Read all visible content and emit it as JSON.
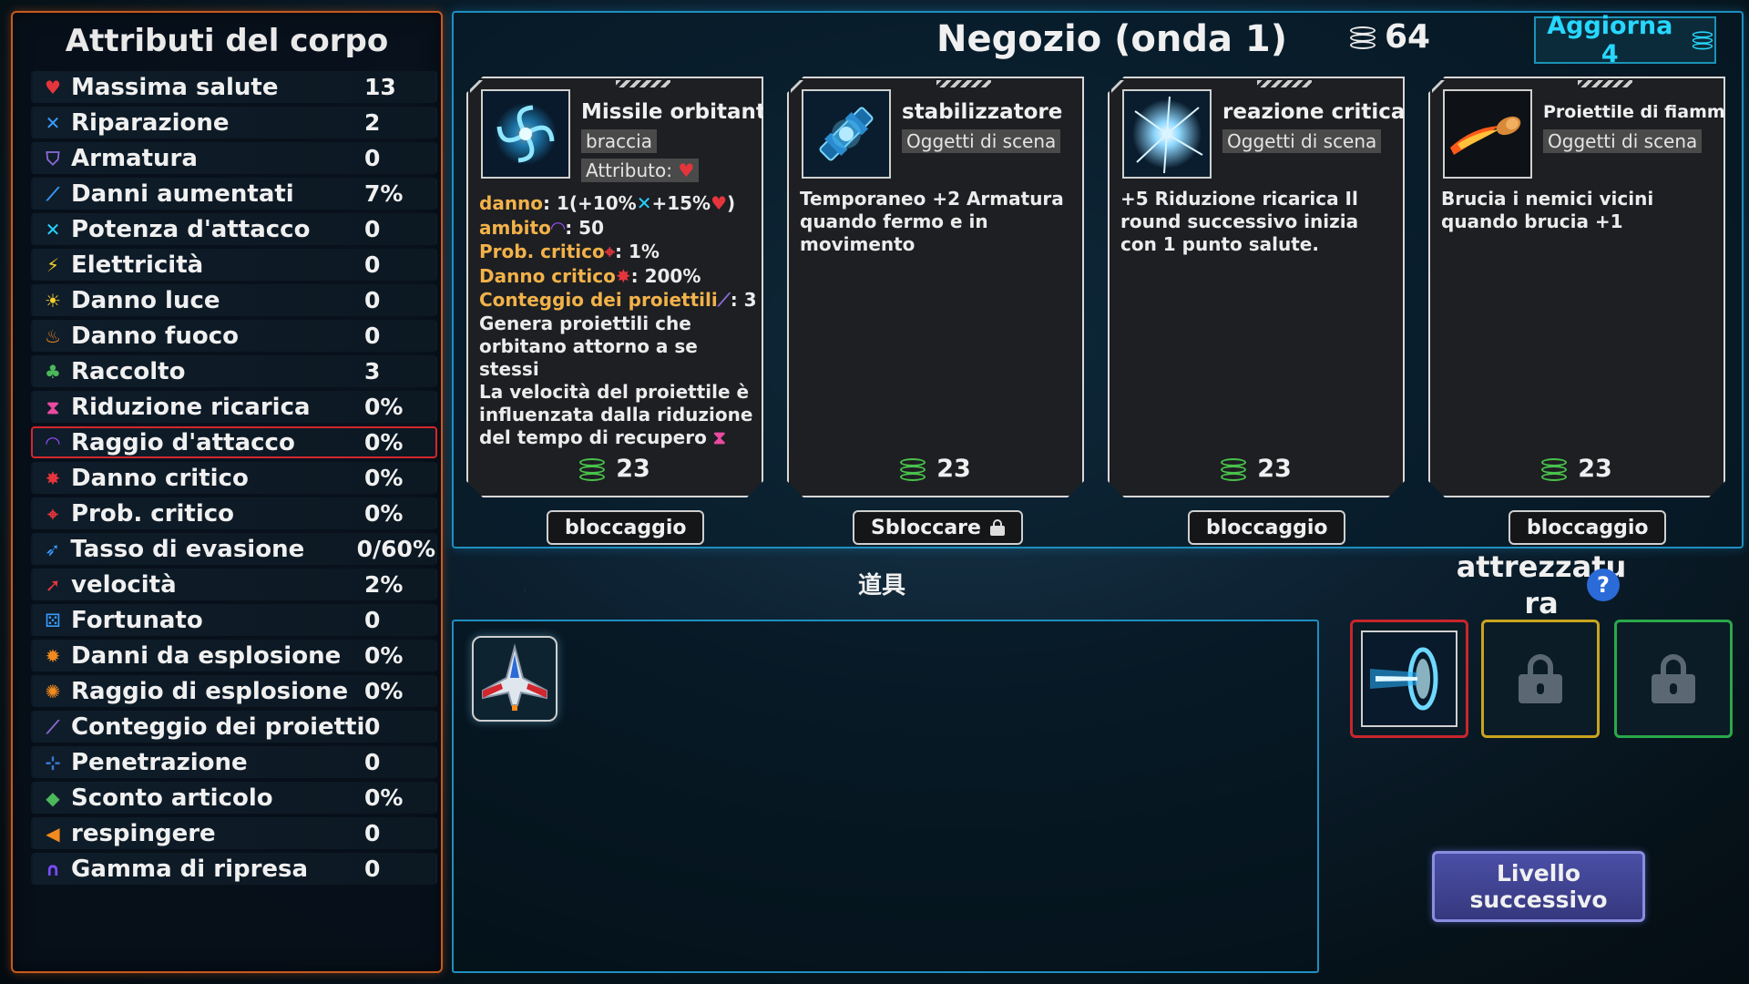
{
  "attributes": {
    "title": "Attributi del corpo",
    "rows": [
      {
        "label": "Massima salute",
        "value": "13",
        "icon": "heart-icon",
        "glyph": "♥",
        "color": "#e5353c"
      },
      {
        "label": "Riparazione",
        "value": "2",
        "icon": "wrench-icon",
        "glyph": "✕",
        "color": "#3a9bff"
      },
      {
        "label": "Armatura",
        "value": "0",
        "icon": "shield-icon",
        "glyph": "⛉",
        "color": "#8c6ad8"
      },
      {
        "label": "Danni aumentati",
        "value": "7%",
        "icon": "sword-icon",
        "glyph": "⟋",
        "color": "#3a9bff"
      },
      {
        "label": "Potenza d'attacco",
        "value": "0",
        "icon": "crossed-swords-icon",
        "glyph": "✕",
        "color": "#26d3ff"
      },
      {
        "label": "Elettricità",
        "value": "0",
        "icon": "lightning-icon",
        "glyph": "⚡",
        "color": "#f5cf2a"
      },
      {
        "label": "Danno luce",
        "value": "0",
        "icon": "sun-icon",
        "glyph": "☀",
        "color": "#f5cf2a"
      },
      {
        "label": "Danno fuoco",
        "value": "0",
        "icon": "fire-icon",
        "glyph": "♨",
        "color": "#f28a1e"
      },
      {
        "label": "Raccolto",
        "value": "3",
        "icon": "money-bag-icon",
        "glyph": "♣",
        "color": "#4cb85a"
      },
      {
        "label": "Riduzione ricarica",
        "value": "0%",
        "icon": "hourglass-icon",
        "glyph": "⧗",
        "color": "#ea4aa0"
      },
      {
        "label": "Raggio d'attacco",
        "value": "0%",
        "icon": "range-icon",
        "glyph": "◠",
        "color": "#9c4bff"
      },
      {
        "label": "Danno critico",
        "value": "0%",
        "icon": "crit-damage-icon",
        "glyph": "✸",
        "color": "#e5353c"
      },
      {
        "label": "Prob. critico",
        "value": "0%",
        "icon": "crit-chance-icon",
        "glyph": "⌖",
        "color": "#e5353c"
      },
      {
        "label": "Tasso di evasione",
        "value": "0/60%",
        "icon": "dodge-icon",
        "glyph": "➶",
        "color": "#3a9bff"
      },
      {
        "label": "velocità",
        "value": "2%",
        "icon": "rocket-icon",
        "glyph": "➚",
        "color": "#e5353c"
      },
      {
        "label": "Fortunato",
        "value": "0",
        "icon": "dice-icon",
        "glyph": "⚄",
        "color": "#3a9bff"
      },
      {
        "label": "Danni da esplosione",
        "value": "0%",
        "icon": "explosion-icon",
        "glyph": "✹",
        "color": "#f28a1e"
      },
      {
        "label": "Raggio di esplosione",
        "value": "0%",
        "icon": "blast-radius-icon",
        "glyph": "✺",
        "color": "#f28a1e"
      },
      {
        "label": "Conteggio dei proiettili",
        "value": "0",
        "icon": "projectile-icon",
        "glyph": "⟋",
        "color": "#8c6ad8"
      },
      {
        "label": "Penetrazione",
        "value": "0",
        "icon": "penetration-icon",
        "glyph": "⊹",
        "color": "#3a7bd8"
      },
      {
        "label": "Sconto articolo",
        "value": "0%",
        "icon": "tag-icon",
        "glyph": "◆",
        "color": "#4cb85a"
      },
      {
        "label": "respingere",
        "value": "0",
        "icon": "knockback-icon",
        "glyph": "◀",
        "color": "#f28a1e"
      },
      {
        "label": "Gamma di ripresa",
        "value": "0",
        "icon": "magnet-icon",
        "glyph": "∩",
        "color": "#7a4bff"
      }
    ],
    "selected_index": 10
  },
  "shop": {
    "title": "Negozio (onda 1)",
    "coins": "64",
    "refresh_label": "Aggiorna 4",
    "cards": [
      {
        "name": "Missile orbitante",
        "tag": "braccia",
        "attribute_label": "Attributo:",
        "stats": [
          {
            "key": "danno",
            "value": ": 1(+10%",
            "extra": "+15%",
            "end": ")"
          },
          {
            "key": "ambito",
            "value": ": 50"
          },
          {
            "key": "Prob. critico",
            "value": ": 1%"
          },
          {
            "key": "Danno critico",
            "value": ": 200%"
          },
          {
            "key": "Conteggio dei proiettili",
            "value": ": 3"
          }
        ],
        "desc1": "Genera proiettili che orbitano attorno a se stessi",
        "desc2": "La velocità del proiettile è influenzata dalla riduzione del tempo di recupero",
        "price": "23",
        "lock_label": "bloccaggio"
      },
      {
        "name": "stabilizzatore",
        "tag": "Oggetti di scena",
        "desc": "Temporaneo +2 Armatura quando fermo e in movimento",
        "price": "23",
        "lock_label": "Sbloccare"
      },
      {
        "name": "reazione critica",
        "tag": "Oggetti di scena",
        "desc": "+5 Riduzione ricarica Il round successivo inizia con 1 punto salute.",
        "price": "23",
        "lock_label": "bloccaggio"
      },
      {
        "name": "Proiettile di fiamma",
        "tag": "Oggetti di scena",
        "desc": "Brucia i nemici vicini quando brucia +1",
        "price": "23",
        "lock_label": "bloccaggio"
      }
    ]
  },
  "props": {
    "label": "道具"
  },
  "equipment": {
    "label": "attrezzatu ra"
  },
  "next_level": {
    "label": "Livello successivo"
  }
}
